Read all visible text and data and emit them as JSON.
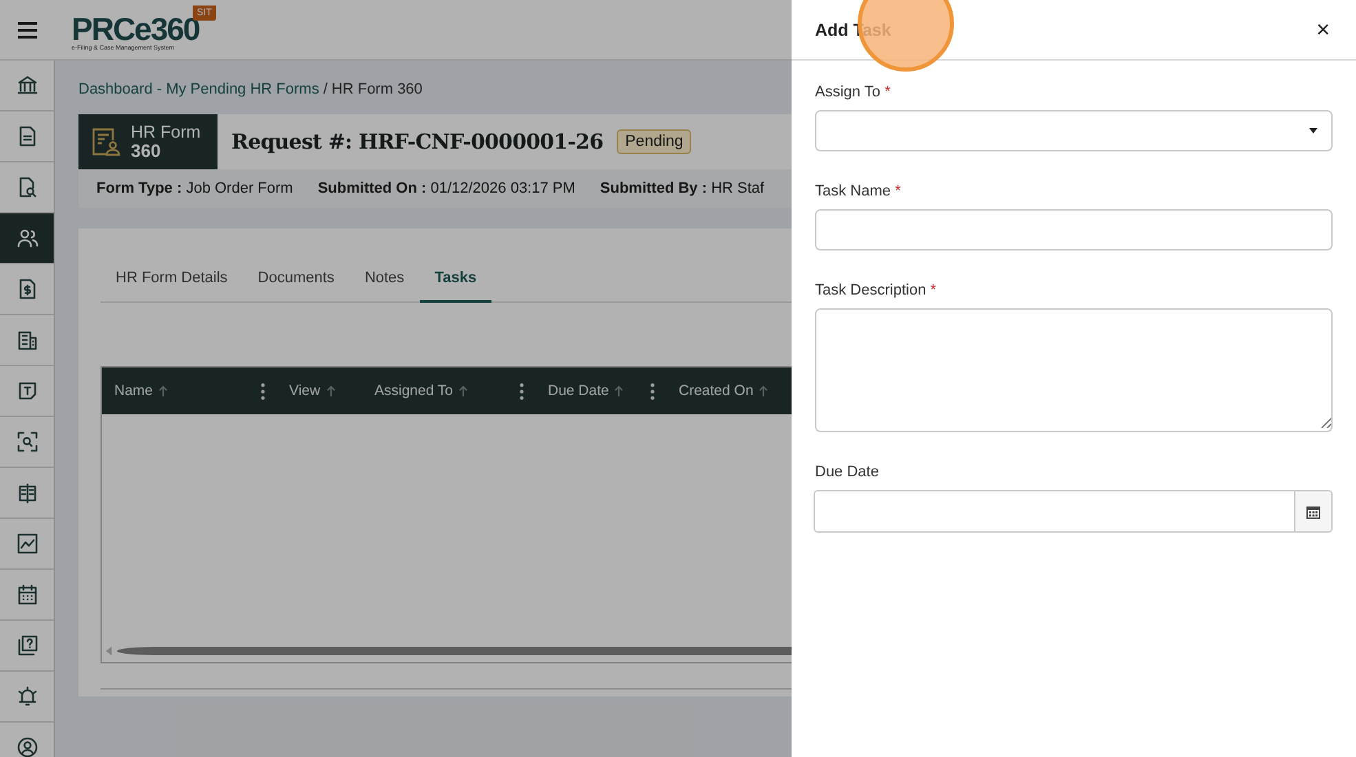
{
  "app": {
    "logo_text": "PRCe360",
    "tagline": "e-Filing & Case Management System",
    "environment_badge": "SIT"
  },
  "sidebar": {
    "items": [
      {
        "selected": false
      },
      {
        "selected": false
      },
      {
        "selected": false
      },
      {
        "selected": true
      },
      {
        "selected": false
      },
      {
        "selected": false
      },
      {
        "selected": false
      },
      {
        "selected": false
      },
      {
        "selected": false
      },
      {
        "selected": false
      },
      {
        "selected": false
      },
      {
        "selected": false
      },
      {
        "selected": false
      },
      {
        "selected": false
      }
    ]
  },
  "breadcrumb": {
    "items": [
      {
        "label": "Dashboard - My Pending HR Forms",
        "link": true
      },
      {
        "label": "HR Form 360",
        "link": false
      }
    ],
    "separator": "/"
  },
  "request": {
    "form_badge": {
      "line_1": "HR Form",
      "line_2": "360"
    },
    "title": "Request #: HRF-CNF-0000001-26",
    "status": "Pending",
    "meta": [
      {
        "label": "Form Type :",
        "value": "Job Order Form"
      },
      {
        "label": "Submitted On :",
        "value": "01/12/2026 03:17 PM"
      },
      {
        "label": "Submitted By :",
        "value": "HR Staf"
      }
    ]
  },
  "tabs": [
    {
      "label": "HR Form Details",
      "selected": false
    },
    {
      "label": "Documents",
      "selected": false
    },
    {
      "label": "Notes",
      "selected": false
    },
    {
      "label": "Tasks",
      "selected": true
    }
  ],
  "table": {
    "columns": [
      {
        "label": "Name",
        "sortable": true,
        "menu": true
      },
      {
        "label": "View",
        "sortable": true,
        "menu": false
      },
      {
        "label": "Assigned To",
        "sortable": true,
        "menu": true
      },
      {
        "label": "Due Date",
        "sortable": true,
        "menu": true
      },
      {
        "label": "Created On",
        "sortable": true,
        "menu": false
      }
    ]
  },
  "drawer": {
    "title": "Add Task",
    "close": "×",
    "fields": [
      {
        "label": "Assign To",
        "required_mark": "*",
        "kind": "select"
      },
      {
        "label": "Task Name",
        "required_mark": "*",
        "kind": "text"
      },
      {
        "label": "Task Description",
        "required_mark": "*",
        "kind": "textarea"
      },
      {
        "label": "Due Date",
        "kind": "date"
      }
    ]
  }
}
